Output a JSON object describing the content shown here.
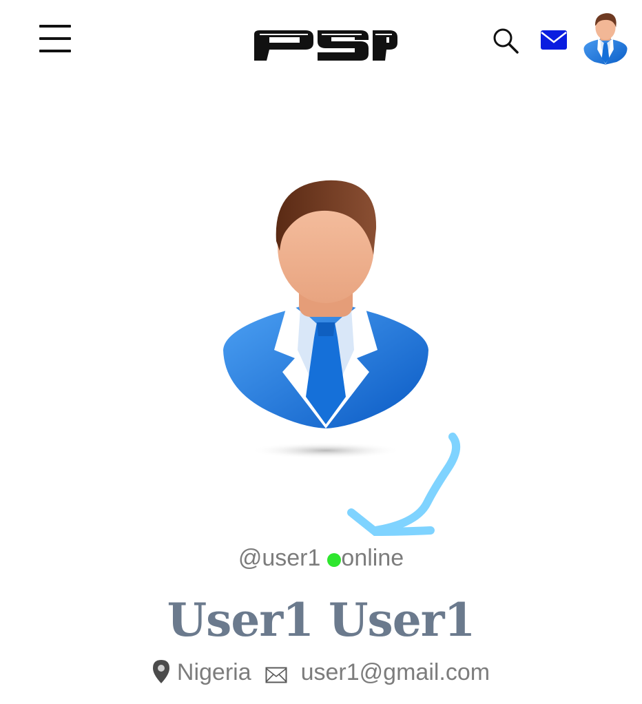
{
  "header": {
    "menu_icon": "hamburger-icon",
    "logo_text": "PSP",
    "search_icon": "search-icon",
    "mail_icon": "envelope-icon",
    "avatar_icon": "user-avatar"
  },
  "profile": {
    "username": "@user1",
    "status": "online",
    "display_name": "User1 User1",
    "location": "Nigeria",
    "email": "user1@gmail.com"
  },
  "colors": {
    "online": "#2ee62e",
    "mail_icon": "#0a1de0",
    "name": "#6b7a8d",
    "muted_text": "#7c7c7c",
    "annotation_arrow": "#7fd3ff"
  }
}
